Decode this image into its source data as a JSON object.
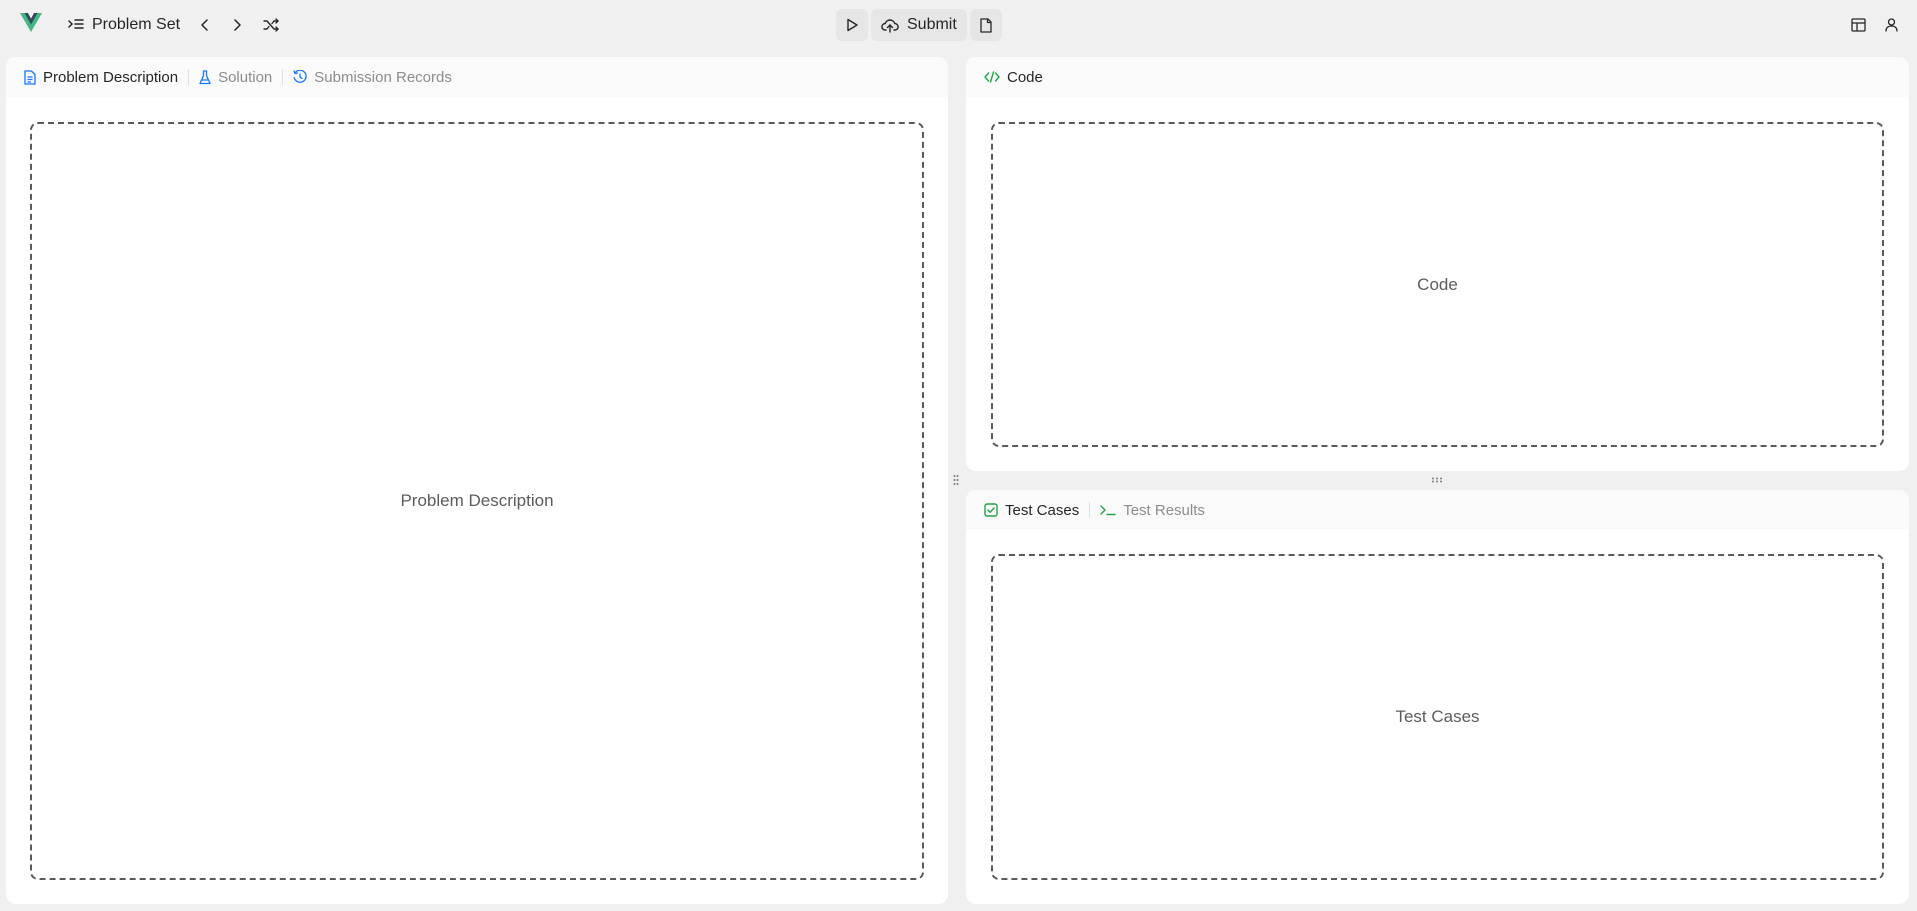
{
  "header": {
    "problem_set_label": "Problem Set",
    "submit_label": "Submit"
  },
  "left_panel": {
    "tabs": [
      {
        "label": "Problem Description",
        "icon": "file-text-icon",
        "active": true
      },
      {
        "label": "Solution",
        "icon": "flask-icon",
        "active": false
      },
      {
        "label": "Submission Records",
        "icon": "history-icon",
        "active": false
      }
    ],
    "placeholder": "Problem Description"
  },
  "code_panel": {
    "tabs": [
      {
        "label": "Code",
        "icon": "code-icon",
        "active": true
      }
    ],
    "placeholder": "Code"
  },
  "test_panel": {
    "tabs": [
      {
        "label": "Test Cases",
        "icon": "checkbox-icon",
        "active": true
      },
      {
        "label": "Test Results",
        "icon": "terminal-icon",
        "active": false
      }
    ],
    "placeholder": "Test Cases"
  },
  "colors": {
    "background": "#f0f0f0",
    "panel": "#ffffff",
    "tabbar": "#fafafa",
    "blue_icon": "#1677ff",
    "green_icon": "#22a34a",
    "vue_green": "#42b883",
    "vue_dark": "#35495e"
  }
}
